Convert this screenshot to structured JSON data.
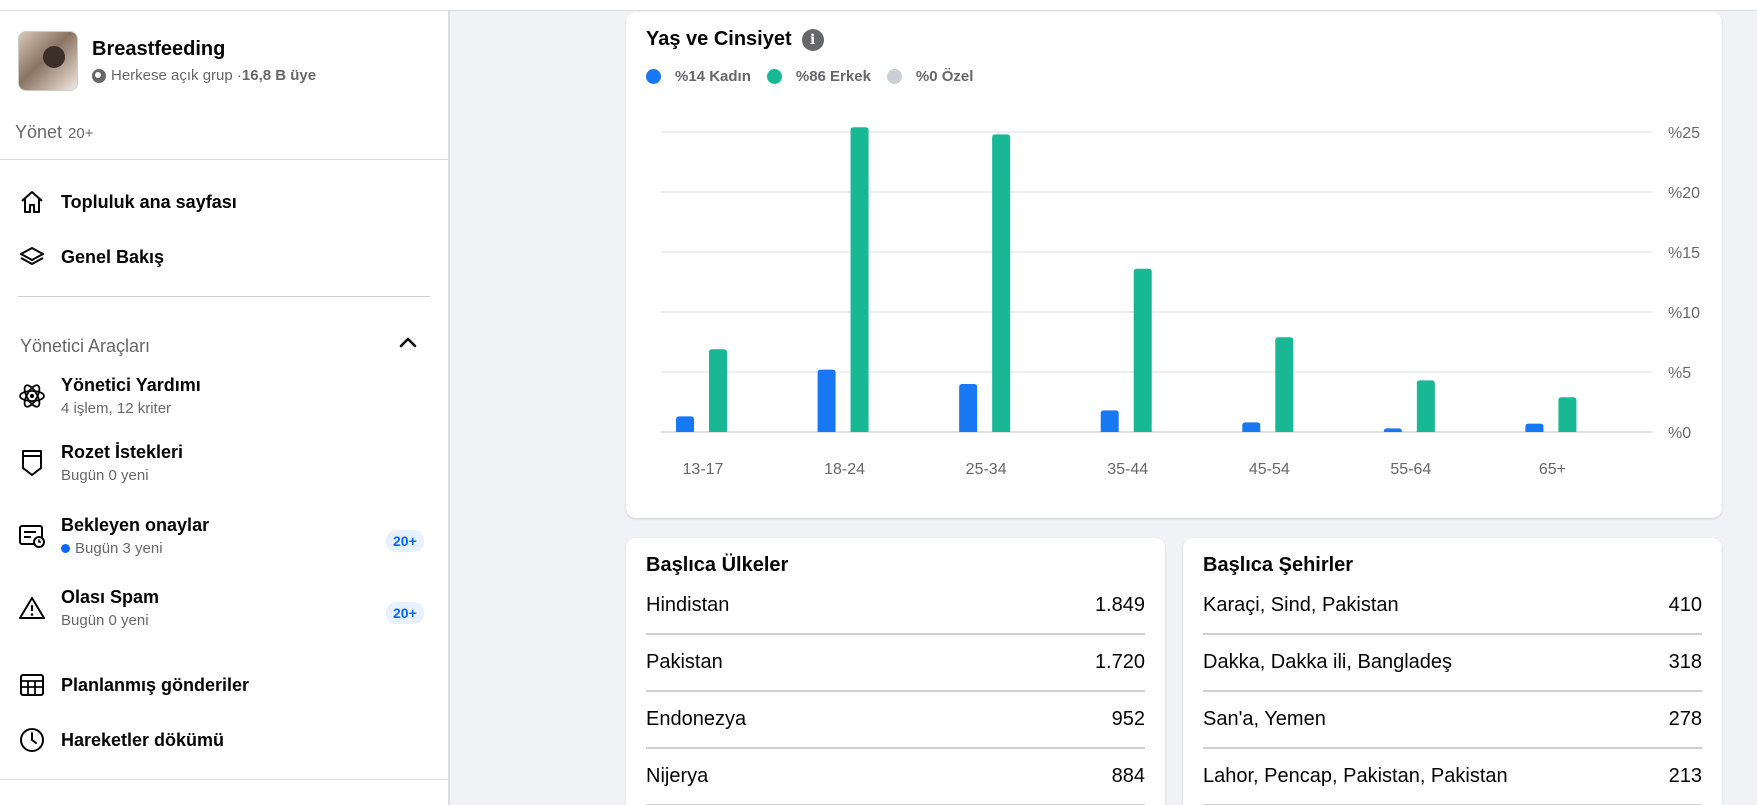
{
  "sidebar": {
    "group_name": "Breastfeeding",
    "group_privacy": "Herkese açık grup · ",
    "group_members": "16,8 B üye",
    "manage_label": "Yönet",
    "manage_count": "20+",
    "nav": [
      {
        "label": "Topluluk ana sayfası",
        "icon": "home-icon"
      },
      {
        "label": "Genel Bakış",
        "icon": "layers-icon"
      }
    ],
    "admin_tools_title": "Yönetici Araçları",
    "admin_tools": [
      {
        "label": "Yönetici Yardımı",
        "sub": "4 işlem, 12 kriter",
        "icon": "atom-icon"
      },
      {
        "label": "Rozet İstekleri",
        "sub": "Bugün 0 yeni",
        "icon": "badge-shield-icon"
      },
      {
        "label": "Bekleyen onaylar",
        "sub": "Bugün 3 yeni",
        "icon": "pending-approval-icon",
        "badge": "20+"
      },
      {
        "label": "Olası Spam",
        "sub": "Bugün 0 yeni",
        "icon": "warning-icon",
        "badge": "20+"
      },
      {
        "label": "Planlanmış gönderiler",
        "icon": "calendar-grid-icon"
      },
      {
        "label": "Hareketler dökümü",
        "icon": "clock-icon"
      }
    ]
  },
  "colors": {
    "female": "#1877f2",
    "male": "#17b893",
    "other": "#ccd0d5"
  },
  "chart_data": {
    "type": "bar",
    "title": "Yaş ve Cinsiyet",
    "legend": [
      "%14 Kadın",
      "%86 Erkek",
      "%0 Özel"
    ],
    "categories": [
      "13-17",
      "18-24",
      "25-34",
      "35-44",
      "45-54",
      "55-64",
      "65+"
    ],
    "series": [
      {
        "name": "Kadın",
        "values": [
          1.3,
          5.2,
          4.0,
          1.8,
          0.8,
          0.3,
          0.7
        ]
      },
      {
        "name": "Erkek",
        "values": [
          6.9,
          25.4,
          24.8,
          13.6,
          7.9,
          4.3,
          2.9
        ]
      }
    ],
    "yticks": [
      "%0",
      "%5",
      "%10",
      "%15",
      "%20",
      "%25"
    ],
    "ylim": [
      0,
      25
    ],
    "legend_position": "top-left",
    "grid": true
  },
  "countries": {
    "title": "Başlıca Ülkeler",
    "rows": [
      {
        "name": "Hindistan",
        "value": "1.849"
      },
      {
        "name": "Pakistan",
        "value": "1.720"
      },
      {
        "name": "Endonezya",
        "value": "952"
      },
      {
        "name": "Nijerya",
        "value": "884"
      }
    ]
  },
  "cities": {
    "title": "Başlıca Şehirler",
    "rows": [
      {
        "name": "Karaçi, Sind, Pakistan",
        "value": "410"
      },
      {
        "name": "Dakka, Dakka ili, Bangladeş",
        "value": "318"
      },
      {
        "name": "San'a, Yemen",
        "value": "278"
      },
      {
        "name": "Lahor, Pencap, Pakistan, Pakistan",
        "value": "213"
      }
    ]
  }
}
